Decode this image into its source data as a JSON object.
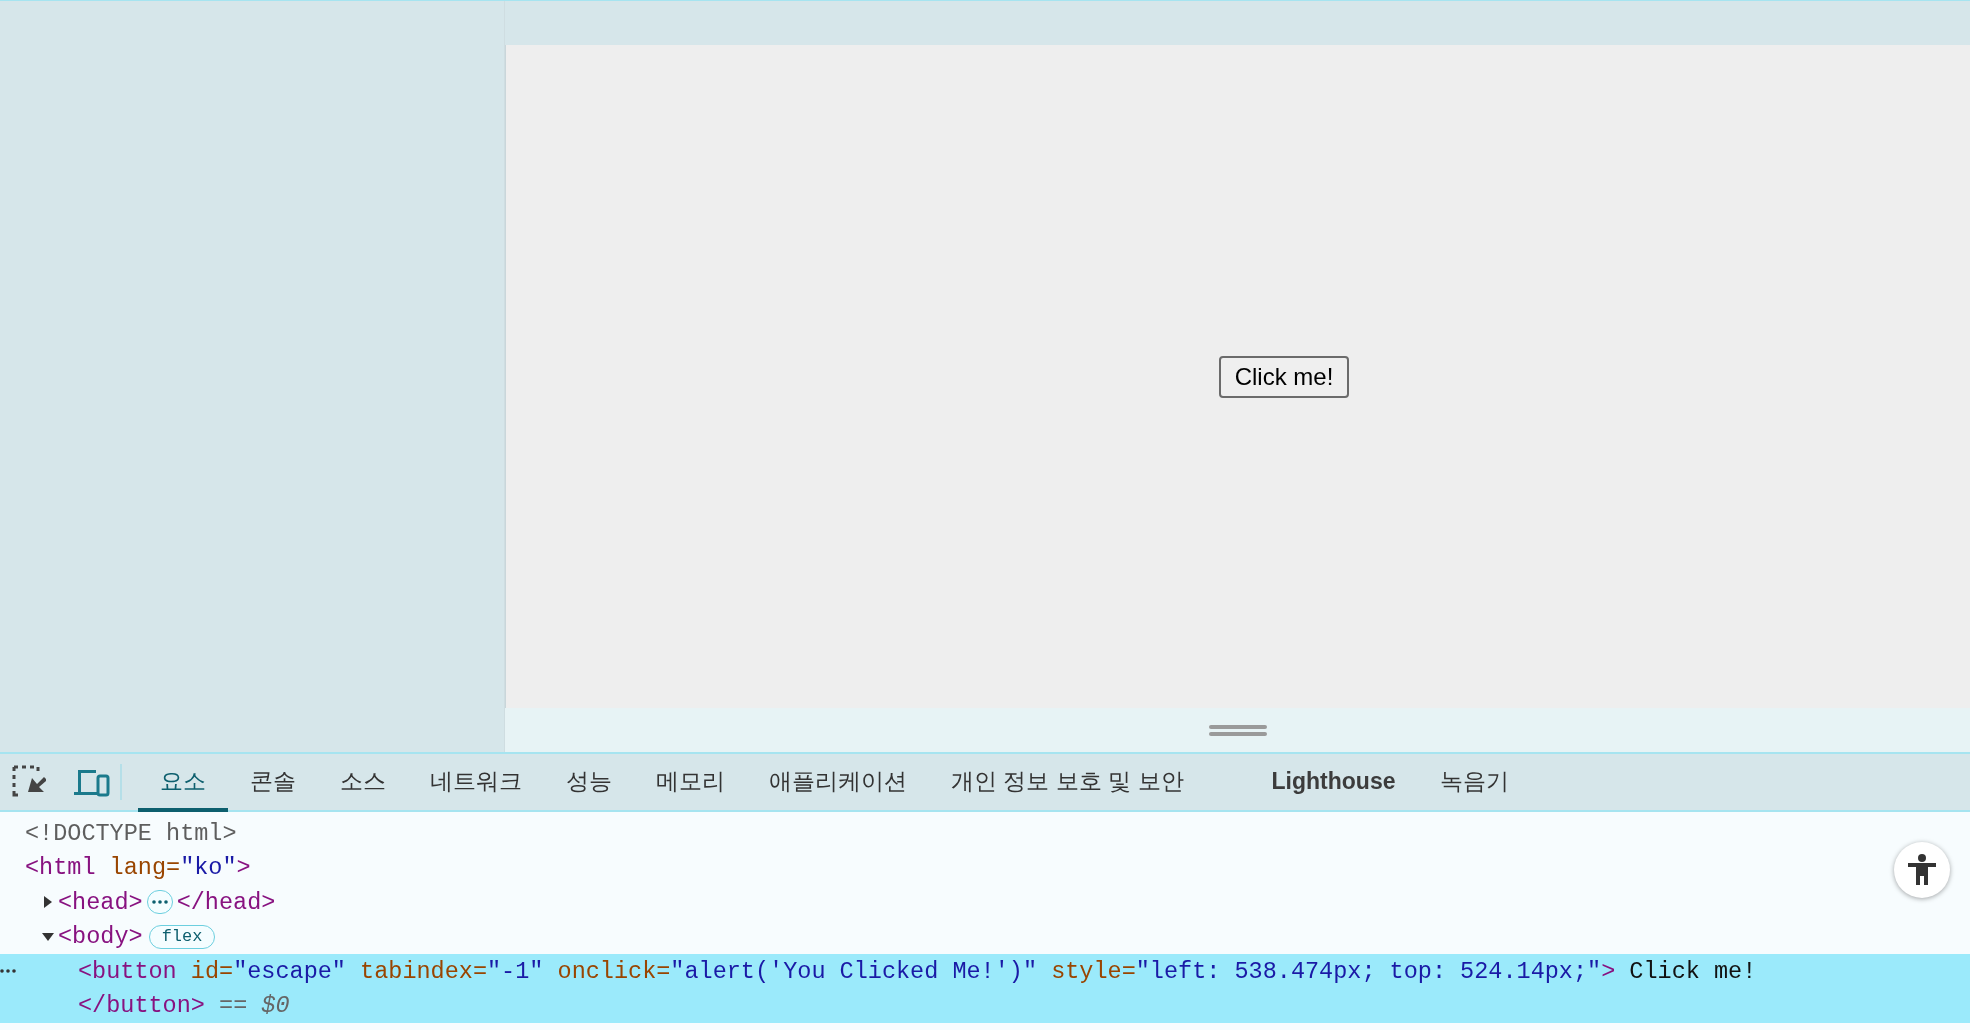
{
  "viewport": {
    "button": {
      "label": "Click me!"
    }
  },
  "toolbar": {
    "tabs": [
      {
        "label": "요소",
        "selected": true,
        "kind": "panel"
      },
      {
        "label": "콘솔",
        "selected": false,
        "kind": "panel"
      },
      {
        "label": "소스",
        "selected": false,
        "kind": "panel"
      },
      {
        "label": "네트워크",
        "selected": false,
        "kind": "panel"
      },
      {
        "label": "성능",
        "selected": false,
        "kind": "panel"
      },
      {
        "label": "메모리",
        "selected": false,
        "kind": "panel"
      },
      {
        "label": "애플리케이션",
        "selected": false,
        "kind": "panel"
      },
      {
        "label": "개인 정보 보호 및 보안",
        "selected": false,
        "kind": "panel"
      },
      {
        "label": "Lighthouse",
        "selected": false,
        "kind": "extension"
      },
      {
        "label": "녹음기",
        "selected": false,
        "kind": "panel"
      }
    ]
  },
  "dom_tree": [
    {
      "selected": false,
      "lines": [
        [
          {
            "kind": "doctype",
            "text": "<!DOCTYPE html>"
          }
        ]
      ]
    },
    {
      "selected": false,
      "lines": [
        [
          {
            "kind": "tag",
            "text": "<html"
          },
          {
            "kind": "attr",
            "text": " lang"
          },
          {
            "kind": "eq",
            "text": "="
          },
          {
            "kind": "value",
            "text": "\"ko\""
          },
          {
            "kind": "tag",
            "text": ">"
          }
        ]
      ],
      "children": [
        {
          "selected": false,
          "expanded": false,
          "lines": [
            [
              {
                "kind": "tag",
                "text": "<head>"
              },
              {
                "kind": "ellipsis"
              },
              {
                "kind": "tag",
                "text": "</head>"
              }
            ]
          ]
        },
        {
          "selected": false,
          "expanded": true,
          "lines": [
            [
              {
                "kind": "tag",
                "text": "<body>"
              },
              {
                "kind": "badge",
                "text": "flex"
              }
            ]
          ],
          "children": [
            {
              "selected": true,
              "lines": [
                [
                  {
                    "kind": "tag",
                    "text": "<button"
                  },
                  {
                    "kind": "attr",
                    "text": " id"
                  },
                  {
                    "kind": "eq",
                    "text": "="
                  },
                  {
                    "kind": "value",
                    "text": "\"escape\""
                  },
                  {
                    "kind": "attr",
                    "text": " tabindex"
                  },
                  {
                    "kind": "eq",
                    "text": "="
                  },
                  {
                    "kind": "value",
                    "text": "\"-1\""
                  },
                  {
                    "kind": "attr",
                    "text": " onclick"
                  },
                  {
                    "kind": "eq",
                    "text": "="
                  },
                  {
                    "kind": "value",
                    "text": "\"alert('You Clicked Me!')\""
                  },
                  {
                    "kind": "attr",
                    "text": " style"
                  },
                  {
                    "kind": "eq",
                    "text": "="
                  },
                  {
                    "kind": "value",
                    "text": "\"left: 538.474px; top: 524.14px;\""
                  },
                  {
                    "kind": "tag",
                    "text": ">"
                  },
                  {
                    "kind": "text",
                    "text": " Click me!"
                  }
                ],
                [
                  {
                    "kind": "tag",
                    "text": "</button>"
                  },
                  {
                    "kind": "hint",
                    "text": " == $0"
                  }
                ]
              ]
            }
          ]
        }
      ]
    }
  ]
}
